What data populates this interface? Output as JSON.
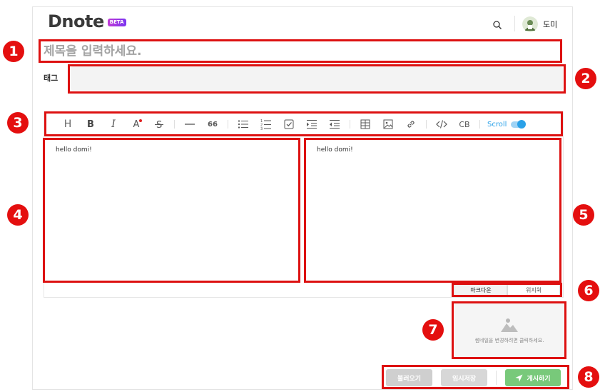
{
  "header": {
    "logo_text": "Dnote",
    "beta_badge": "BETA",
    "username": "도미",
    "icons": [
      "search-icon",
      "avatar"
    ]
  },
  "title": {
    "placeholder": "제목을 입력하세요.",
    "value": ""
  },
  "tags": {
    "label": "태그",
    "value": ""
  },
  "toolbar": {
    "heading": "H",
    "bold": "B",
    "italic": "I",
    "color": "A",
    "quote": "66",
    "codeblock": "CB",
    "scroll_label": "Scroll",
    "scroll_enabled": true,
    "accent_color": "#2aa1e8"
  },
  "editor": {
    "markdown_text": "hello domi!",
    "preview_text": "hello domi!"
  },
  "modes": {
    "markdown": "마크다운",
    "wysiwyg": "위지윅",
    "active": "markdown"
  },
  "thumbnail": {
    "hint": "썸네일을 변경하려면 클릭하세요."
  },
  "actions": {
    "load": "불러오기",
    "draft": "임시저장",
    "publish": "게시하기",
    "publish_color": "#78c97a"
  },
  "annotations": {
    "color": "#dd1111",
    "markers": [
      "1",
      "2",
      "3",
      "4",
      "5",
      "6",
      "7",
      "8"
    ]
  }
}
